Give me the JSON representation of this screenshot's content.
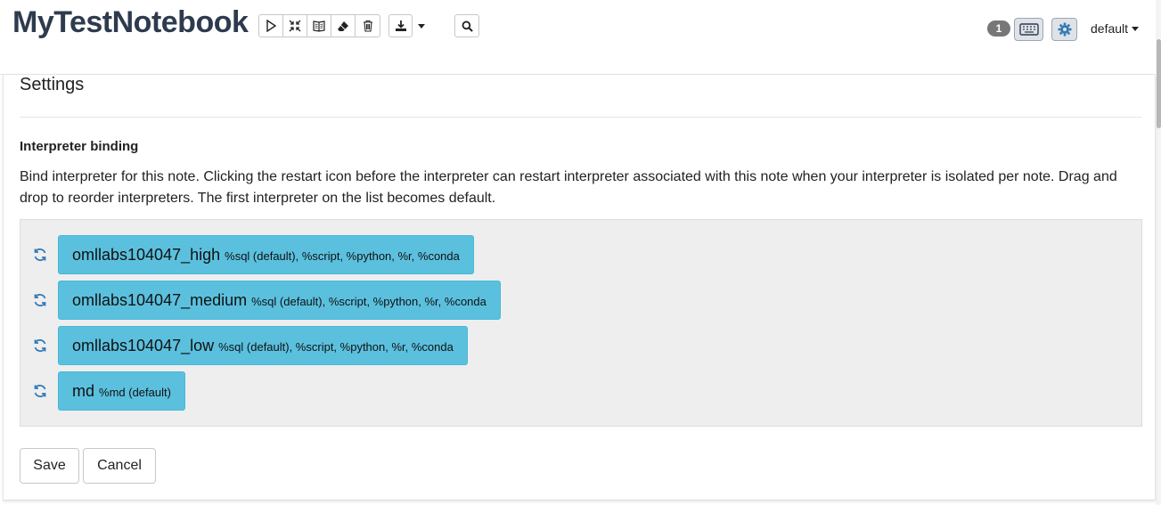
{
  "header": {
    "title": "MyTestNotebook",
    "toolbar_icons": [
      "run-all-icon",
      "collapse-icon",
      "book-icon",
      "eraser-icon",
      "trash-icon"
    ],
    "download_icon": "download-icon",
    "search_icon": "search-icon",
    "badge_count": "1",
    "keyboard_icon": "keyboard-icon",
    "settings_icon": "gear-icon",
    "user_label": "default"
  },
  "settings": {
    "title": "Settings",
    "section_title": "Interpreter binding",
    "description": "Bind interpreter for this note. Clicking the restart icon before the interpreter can restart interpreter associated with this note when your interpreter is isolated per note. Drag and drop to reorder interpreters. The first interpreter on the list becomes default.",
    "interpreters": [
      {
        "name": "omllabs104047_high",
        "modes": "%sql (default), %script, %python, %r, %conda"
      },
      {
        "name": "omllabs104047_medium",
        "modes": "%sql (default), %script, %python, %r, %conda"
      },
      {
        "name": "omllabs104047_low",
        "modes": "%sql (default), %script, %python, %r, %conda"
      },
      {
        "name": "md",
        "modes": "%md (default)"
      }
    ],
    "save_label": "Save",
    "cancel_label": "Cancel"
  },
  "colors": {
    "interpreter_bg": "#5bc0de",
    "title": "#2e3b4e",
    "restart_icon": "#337ab7"
  }
}
